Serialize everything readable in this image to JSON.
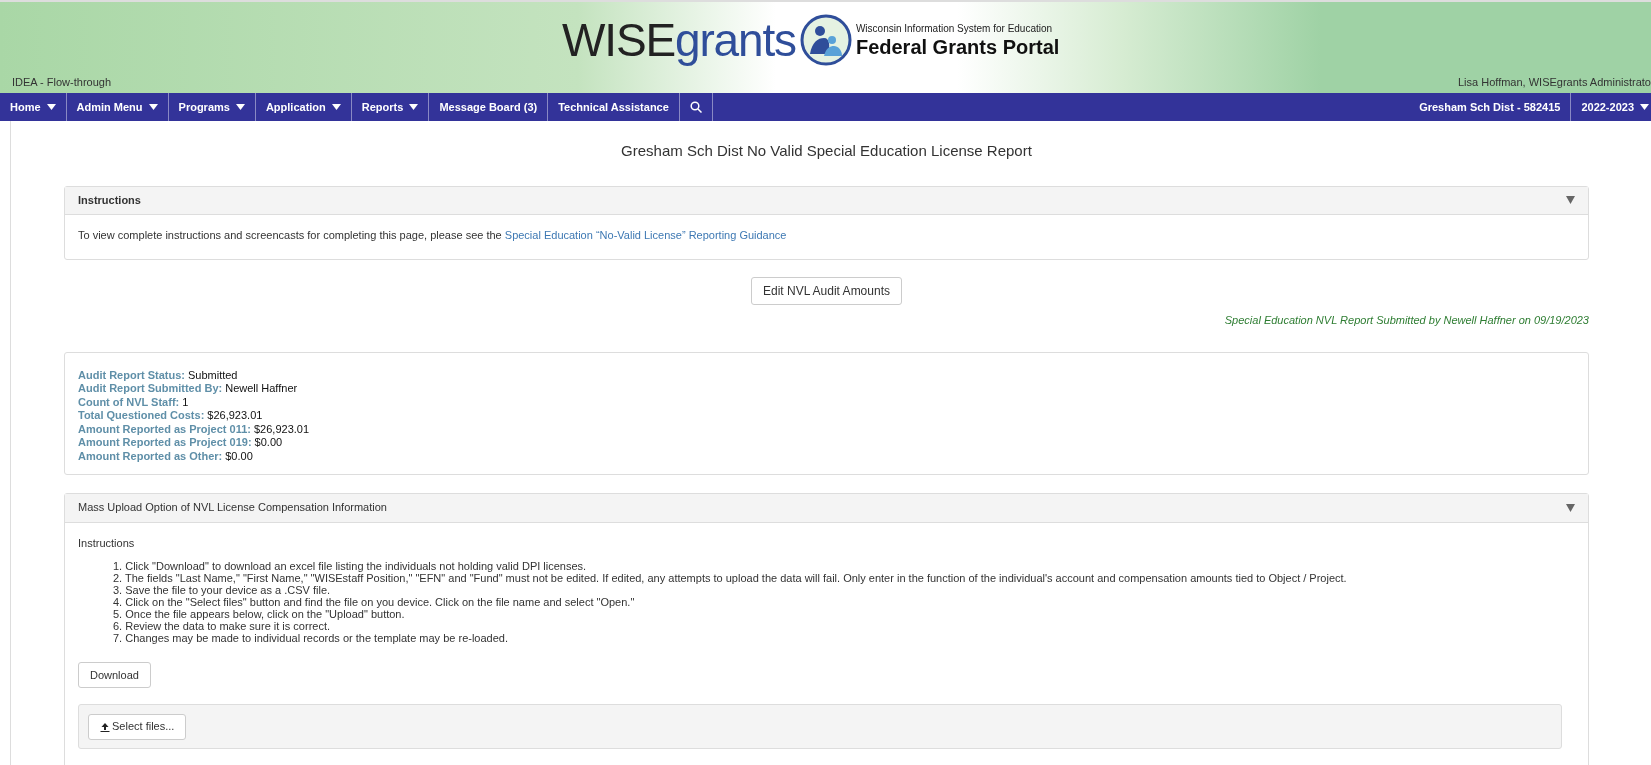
{
  "header": {
    "program": "IDEA - Flow-through",
    "logo_word_1": "WISE",
    "logo_word_2": "grants",
    "logo_subtitle": "Wisconsin Information System for Education",
    "logo_title": "Federal Grants Portal",
    "user": "Lisa Hoffman, WISEgrants Administrato"
  },
  "nav": {
    "items": [
      {
        "label": "Home",
        "dropdown": true
      },
      {
        "label": "Admin Menu",
        "dropdown": true
      },
      {
        "label": "Programs",
        "dropdown": true
      },
      {
        "label": "Application",
        "dropdown": true
      },
      {
        "label": "Reports",
        "dropdown": true
      },
      {
        "label": "Message Board (3)",
        "dropdown": false
      },
      {
        "label": "Technical Assistance",
        "dropdown": false
      }
    ],
    "district": "Gresham Sch Dist - 582415",
    "year": "2022-2023"
  },
  "page_title": "Gresham Sch Dist No Valid Special Education License Report",
  "instructions_panel": {
    "title": "Instructions",
    "expanded": true,
    "text": "To view complete instructions and screencasts for completing this page, please see the",
    "link": "Special Education “No-Valid License” Reporting Guidance"
  },
  "edit_button": "Edit NVL Audit Amounts",
  "submitted_note": "Special Education NVL Report Submitted by Newell Haffner on 09/19/2023",
  "summary": [
    {
      "label": "Audit Report Status:",
      "value": "Submitted"
    },
    {
      "label": "Audit Report Submitted By:",
      "value": "Newell Haffner"
    },
    {
      "label": "Count of NVL Staff:",
      "value": "1"
    },
    {
      "label": "Total Questioned Costs:",
      "value": "$26,923.01"
    },
    {
      "label": "Amount Reported as Project 011:",
      "value": "$26,923.01"
    },
    {
      "label": "Amount Reported as Project 019:",
      "value": "$0.00"
    },
    {
      "label": "Amount Reported as Other:",
      "value": "$0.00"
    }
  ],
  "upload_panel": {
    "title": "Mass Upload Option of NVL License Compensation Information",
    "expanded": true,
    "subtitle": "Instructions",
    "steps": [
      "1. Click \"Download\" to download an excel file listing the individuals not holding valid DPI licenses.",
      "2. The fields \"Last Name,\" \"First Name,\" \"WISEstaff Position,\" \"EFN\" and \"Fund\" must not be edited. If edited, any attempts to upload the data will fail. Only enter in the function of the individual's account and compensation amounts tied to Object / Project.",
      "3. Save the file to your device as a .CSV file.",
      "4. Click on the \"Select files\" button and find the file on you device. Click on the file name and select \"Open.\"",
      "5. Once the file appears below, click on the \"Upload\" button.",
      "6. Review the data to make sure it is correct.",
      "7. Changes may be made to individual records or the template may be re-loaded."
    ],
    "download_button": "Download",
    "select_button": "Select files..."
  }
}
